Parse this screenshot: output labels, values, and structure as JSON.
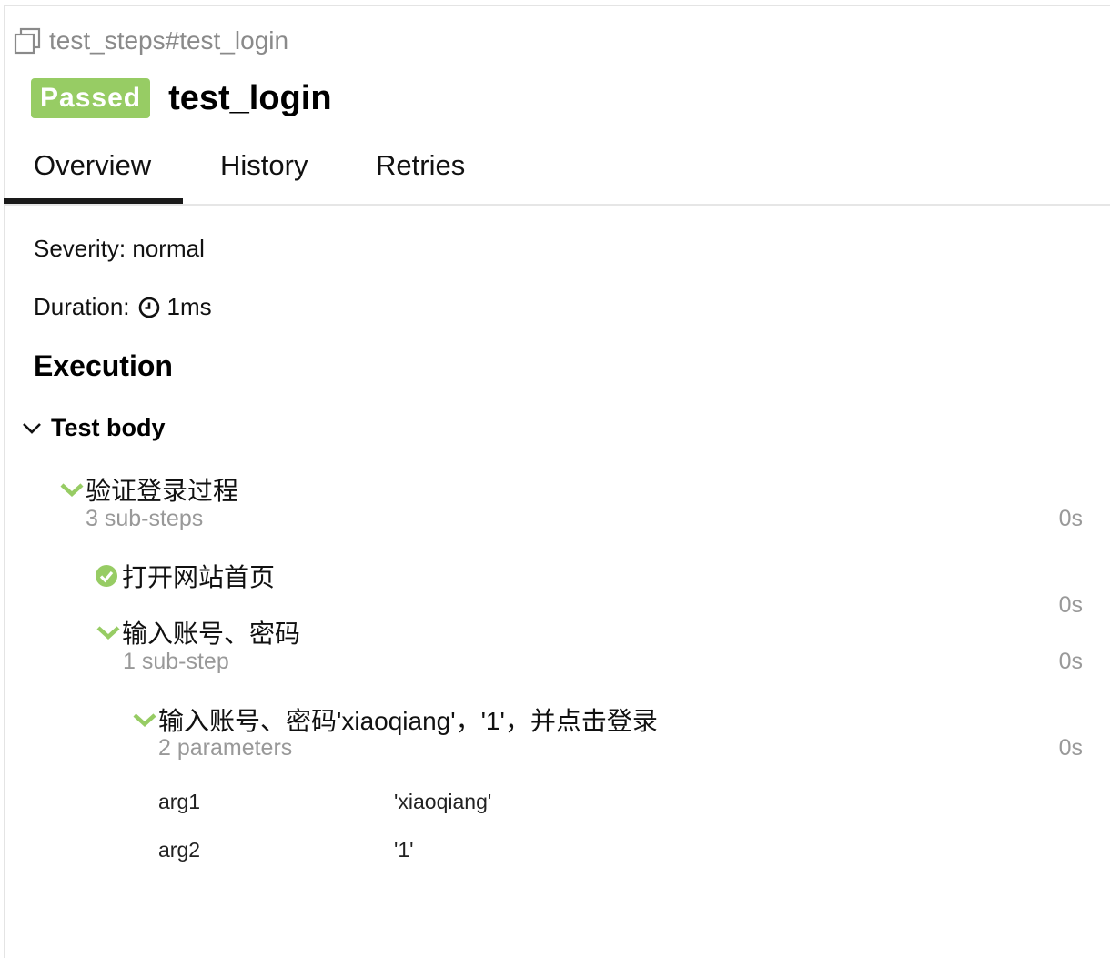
{
  "header": {
    "uid": "test_steps#test_login",
    "status": "Passed",
    "title": "test_login"
  },
  "tabs": [
    {
      "label": "Overview",
      "active": true
    },
    {
      "label": "History",
      "active": false
    },
    {
      "label": "Retries",
      "active": false
    }
  ],
  "overview": {
    "severity": "Severity: normal",
    "duration_label": "Duration:",
    "duration_value": "1ms",
    "execution_heading": "Execution",
    "test_body_label": "Test body"
  },
  "steps": {
    "s1": {
      "title": "验证登录过程",
      "sub": "3 sub-steps",
      "duration": "0s"
    },
    "s2": {
      "title": "打开网站首页",
      "duration": "0s"
    },
    "s3": {
      "title": "输入账号、密码",
      "sub": "1 sub-step",
      "duration": "0s"
    },
    "s4": {
      "title": "输入账号、密码'xiaoqiang'，'1'，并点击登录",
      "sub": "2 parameters",
      "duration": "0s"
    }
  },
  "parameters": [
    {
      "name": "arg1",
      "value": "'xiaoqiang'"
    },
    {
      "name": "arg2",
      "value": "'1'"
    }
  ],
  "colors": {
    "passed": "#97cc64",
    "muted_text": "#999999"
  },
  "icons": {
    "uid": "copy-icon",
    "duration": "clock-icon",
    "test_body": "chevron-down-icon",
    "step_expand": "green-chevron-down-icon",
    "step_status": "check-circle-icon"
  }
}
